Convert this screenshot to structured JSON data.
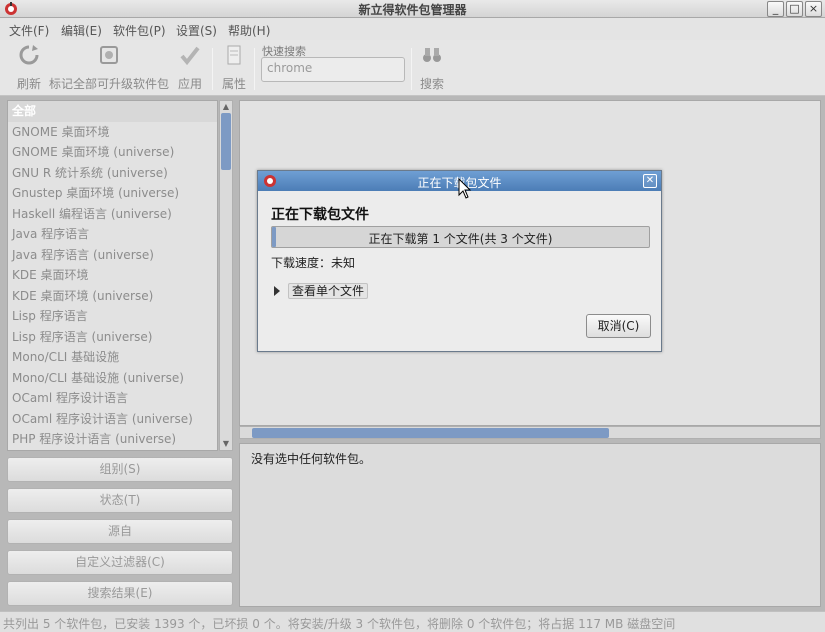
{
  "window": {
    "title": "新立得软件包管理器",
    "controls": {
      "minimize": "_",
      "maximize": "□",
      "close": "×"
    }
  },
  "menu": [
    "文件(F)",
    "编辑(E)",
    "软件包(P)",
    "设置(S)",
    "帮助(H)"
  ],
  "toolbar": {
    "refresh": "刷新",
    "mark_all_upgrades": "标记全部可升级软件包",
    "apply": "应用",
    "properties": "属性",
    "quick_search_label": "快速搜索",
    "quick_search_value": "chrome",
    "search": "搜索"
  },
  "categories": [
    "全部",
    "GNOME 桌面环境",
    "GNOME 桌面环境 (universe)",
    "GNU R 统计系统 (universe)",
    "Gnustep 桌面环境 (universe)",
    "Haskell 编程语言 (universe)",
    "Java 程序语言",
    "Java 程序语言 (universe)",
    "KDE 桌面环境",
    "KDE 桌面环境 (universe)",
    "Lisp 程序语言",
    "Lisp 程序语言 (universe)",
    "Mono/CLI 基础设施",
    "Mono/CLI 基础设施 (universe)",
    "OCaml 程序设计语言",
    "OCaml 程序设计语言 (universe)",
    "PHP 程序设计语言 (universe)"
  ],
  "filter_buttons": [
    "组别(S)",
    "状态(T)",
    "源自",
    "自定义过滤器(C)",
    "搜索结果(E)"
  ],
  "details": {
    "text": "没有选中任何软件包。"
  },
  "status": {
    "text": "共列出 5 个软件包，已安装 1393 个，已坏损 0 个。将安装/升级 3 个软件包，将删除 0 个软件包；将占据 117 MB 磁盘空间"
  },
  "dialog": {
    "title": "正在下载包文件",
    "heading": "正在下载包文件",
    "progress_label": "正在下载第 1 个文件(共 3 个文件)",
    "progress_fraction": 0.01,
    "speed": "下载速度：未知",
    "expander": "查看单个文件",
    "cancel": "取消(C)"
  },
  "colors": {
    "accent": "#7d9ac4",
    "dialog_title": "#5a8bc4"
  }
}
